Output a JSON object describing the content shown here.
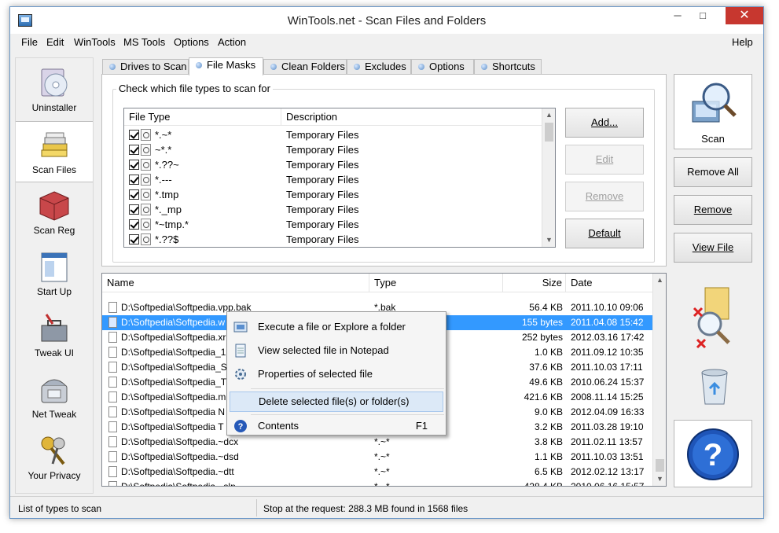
{
  "window": {
    "title": "WinTools.net - Scan Files and Folders"
  },
  "menu": [
    "File",
    "Edit",
    "WinTools",
    "MS Tools",
    "Options",
    "Action",
    "Help"
  ],
  "sidebar": {
    "items": [
      {
        "label": "Uninstaller",
        "icon": "uninstaller-cd-icon"
      },
      {
        "label": "Scan Files",
        "icon": "scan-files-stack-icon",
        "active": true
      },
      {
        "label": "Scan Reg",
        "icon": "scan-reg-cube-icon"
      },
      {
        "label": "Start Up",
        "icon": "startup-window-icon"
      },
      {
        "label": "Tweak UI",
        "icon": "tweak-ui-toolbox-icon"
      },
      {
        "label": "Net Tweak",
        "icon": "net-tweak-phone-icon"
      },
      {
        "label": "Your Privacy",
        "icon": "privacy-keys-icon"
      }
    ]
  },
  "tabs": [
    {
      "label": "Drives to Scan"
    },
    {
      "label": "File Masks",
      "active": true
    },
    {
      "label": "Clean Folders"
    },
    {
      "label": "Excludes"
    },
    {
      "label": "Options"
    },
    {
      "label": "Shortcuts"
    }
  ],
  "masks": {
    "group_title": "Check which file types to scan for",
    "columns": {
      "file_type": "File Type",
      "description": "Description"
    },
    "rows": [
      {
        "type": "*.~*",
        "desc": "Temporary Files",
        "checked": true
      },
      {
        "type": "~*.*",
        "desc": "Temporary Files",
        "checked": true
      },
      {
        "type": "*.??~",
        "desc": "Temporary Files",
        "checked": true
      },
      {
        "type": "*.---",
        "desc": "Temporary Files",
        "checked": true
      },
      {
        "type": "*.tmp",
        "desc": "Temporary Files",
        "checked": true
      },
      {
        "type": "*._mp",
        "desc": "Temporary Files",
        "checked": true
      },
      {
        "type": "*~tmp.*",
        "desc": "Temporary Files",
        "checked": true
      },
      {
        "type": "*.??$",
        "desc": "Temporary Files",
        "checked": true
      }
    ],
    "buttons": {
      "add": "Add...",
      "edit": "Edit",
      "remove": "Remove",
      "default": "Default"
    }
  },
  "files": {
    "columns": {
      "name": "Name",
      "type": "Type",
      "size": "Size",
      "date": "Date"
    },
    "rows": [
      {
        "name": "D:\\Softpedia\\Softpedia.vpp.bak",
        "type": "*.bak",
        "size": "56.4 KB",
        "date": "2011.10.10 09:06"
      },
      {
        "name": "D:\\Softpedia\\Softpedia.w",
        "type": "",
        "size": "155 bytes",
        "date": "2011.04.08 15:42",
        "selected": true
      },
      {
        "name": "D:\\Softpedia\\Softpedia.xr",
        "type": "",
        "size": "252 bytes",
        "date": "2012.03.16 17:42"
      },
      {
        "name": "D:\\Softpedia\\Softpedia_1",
        "type": "",
        "size": "1.0 KB",
        "date": "2011.09.12 10:35"
      },
      {
        "name": "D:\\Softpedia\\Softpedia_S",
        "type": "",
        "size": "37.6 KB",
        "date": "2011.10.03 17:11"
      },
      {
        "name": "D:\\Softpedia\\Softpedia_T",
        "type": "",
        "size": "49.6 KB",
        "date": "2010.06.24 15:37"
      },
      {
        "name": "D:\\Softpedia\\Softpedia.m",
        "type": "",
        "size": "421.6 KB",
        "date": "2008.11.14 15:25"
      },
      {
        "name": "D:\\Softpedia\\Softpedia N",
        "type": "",
        "size": "9.0 KB",
        "date": "2012.04.09 16:33"
      },
      {
        "name": "D:\\Softpedia\\Softpedia T",
        "type": "",
        "size": "3.2 KB",
        "date": "2011.03.28 19:10"
      },
      {
        "name": "D:\\Softpedia\\Softpedia.~dcx",
        "type": "*.~*",
        "size": "3.8 KB",
        "date": "2011.02.11 13:57"
      },
      {
        "name": "D:\\Softpedia\\Softpedia.~dsd",
        "type": "*.~*",
        "size": "1.1 KB",
        "date": "2011.10.03 13:51"
      },
      {
        "name": "D:\\Softpedia\\Softpedia.~dtt",
        "type": "*.~*",
        "size": "6.5 KB",
        "date": "2012.02.12 13:17"
      },
      {
        "name": "D:\\Softpedia\\Softpedia.~slp",
        "type": "*.~*",
        "size": "428.4 KB",
        "date": "2010.06.16 15:57"
      }
    ]
  },
  "context_menu": {
    "items": [
      {
        "label": "Execute a file or Explore a folder",
        "icon": "execute-icon"
      },
      {
        "label": "View selected file in Notepad",
        "icon": "notepad-icon"
      },
      {
        "label": "Properties of selected file",
        "icon": "properties-gear-icon"
      },
      {
        "label": "Delete selected file(s) or folder(s)",
        "icon": "",
        "hover": true
      },
      {
        "label": "Contents",
        "icon": "help-icon",
        "shortcut": "F1"
      }
    ]
  },
  "right_panel": {
    "scan": "Scan",
    "remove_all": "Remove All",
    "remove": "Remove",
    "view_file": "View File"
  },
  "status": {
    "left": "List of types to scan",
    "right": "Stop at the request: 288.3 MB found in 1568 files"
  }
}
